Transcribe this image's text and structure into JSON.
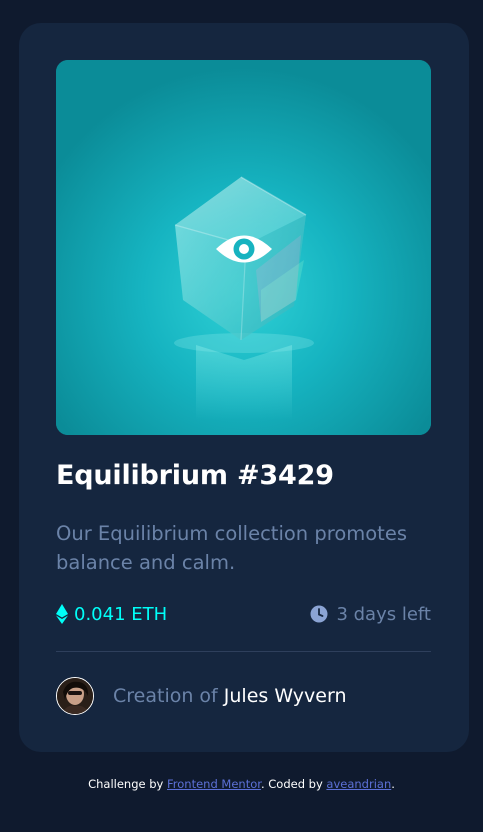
{
  "colors": {
    "page_background": "#0f1a2e",
    "card_background": "#15263f",
    "accent_cyan": "#00fff8",
    "muted_text": "#6b83a8",
    "white": "#ffffff",
    "link": "#5c70d6"
  },
  "card": {
    "image": {
      "alt": "Equilibrium",
      "overlay_icon": "view-icon"
    },
    "title": "Equilibrium #3429",
    "description": "Our Equilibrium collection promotes balance and calm.",
    "price": {
      "icon": "ethereum-icon",
      "value": "0.041 ETH"
    },
    "time_left": {
      "icon": "clock-icon",
      "value": "3 days left"
    },
    "creator": {
      "prefix": "Creation of ",
      "name": "Jules Wyvern"
    }
  },
  "attribution": {
    "prefix": "Challenge by ",
    "link1": "Frontend Mentor",
    "middle": ". Coded by ",
    "link2": "aveandrian",
    "suffix": "."
  }
}
